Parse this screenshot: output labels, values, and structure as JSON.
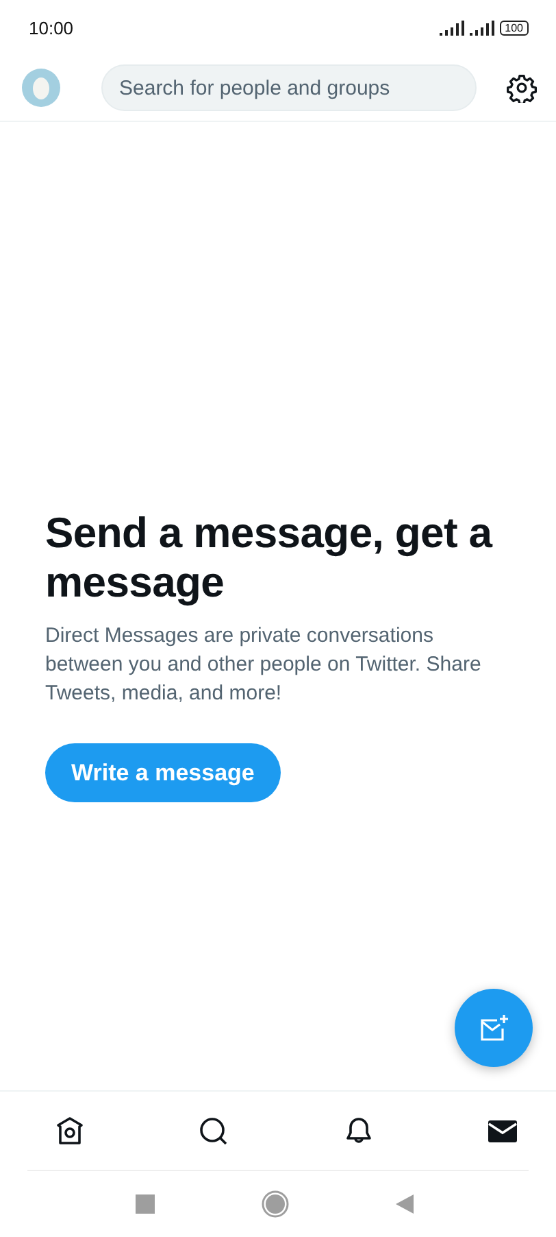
{
  "status_bar": {
    "time": "10:00",
    "battery": "100"
  },
  "header": {
    "search": {
      "placeholder": "Search for people and groups"
    }
  },
  "empty_state": {
    "title": "Send a message, get a message",
    "body": "Direct Messages are private conversations between you and other people on Twitter. Share Tweets, media, and more!",
    "button": "Write a message"
  },
  "bottom_nav": [
    {
      "kind": "home",
      "selected": false
    },
    {
      "kind": "search",
      "selected": false
    },
    {
      "kind": "notifications",
      "selected": false
    },
    {
      "kind": "messages",
      "selected": true
    }
  ]
}
